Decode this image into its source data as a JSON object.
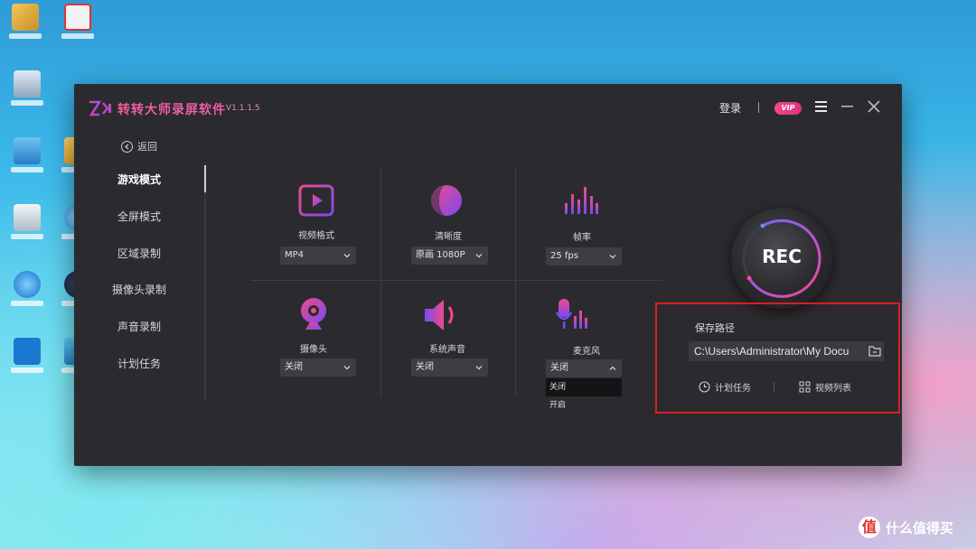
{
  "app": {
    "title": "转转大师录屏软件",
    "version": "V1.1.1.5",
    "login_label": "登录",
    "vip_label": "VIP"
  },
  "sidebar": {
    "back_label": "返回",
    "items": [
      {
        "label": "游戏模式"
      },
      {
        "label": "全屏模式"
      },
      {
        "label": "区域录制"
      },
      {
        "label": "摄像头录制"
      },
      {
        "label": "声音录制"
      },
      {
        "label": "计划任务"
      }
    ]
  },
  "settings": {
    "video_format": {
      "label": "视频格式",
      "value": "MP4",
      "icon": "video-format-icon"
    },
    "clarity": {
      "label": "清晰度",
      "value": "原画 1080P",
      "icon": "clarity-icon"
    },
    "frame_rate": {
      "label": "帧率",
      "value": "25 fps",
      "icon": "frame-rate-icon"
    },
    "camera": {
      "label": "摄像头",
      "value": "关闭",
      "icon": "camera-icon"
    },
    "system_audio": {
      "label": "系统声音",
      "value": "关闭",
      "icon": "speaker-icon"
    },
    "microphone": {
      "label": "麦克风",
      "value": "关闭",
      "icon": "microphone-icon",
      "options": [
        "关闭",
        "开启"
      ]
    }
  },
  "record": {
    "label": "REC"
  },
  "save": {
    "label": "保存路径",
    "path": "C:\\Users\\Administrator\\My Docu",
    "schedule_label": "计划任务",
    "video_list_label": "视频列表"
  },
  "watermark": {
    "text": "什么值得买",
    "logo_char": "值"
  },
  "colors": {
    "accent": "#ec5ea0",
    "highlight_border": "#d42020",
    "window_bg": "#2b2b2f"
  }
}
